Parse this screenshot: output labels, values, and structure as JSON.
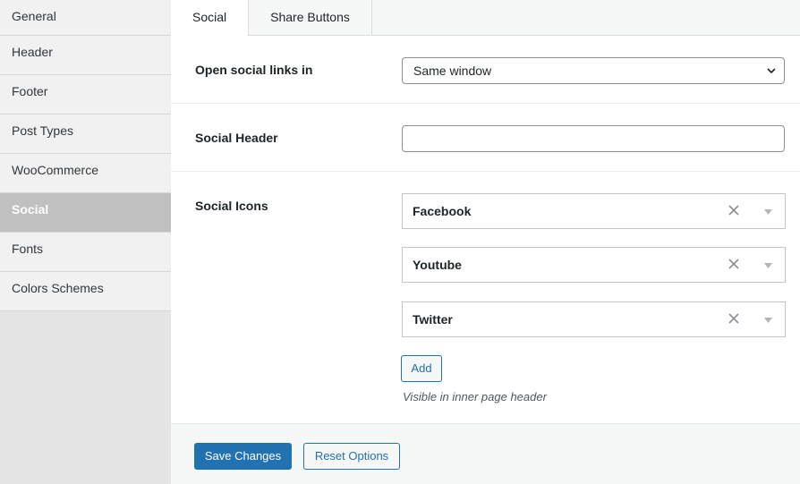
{
  "sidebar": {
    "items": [
      {
        "label": "General"
      },
      {
        "label": "Header"
      },
      {
        "label": "Footer"
      },
      {
        "label": "Post Types"
      },
      {
        "label": "WooCommerce"
      },
      {
        "label": "Social",
        "active": true
      },
      {
        "label": "Fonts"
      },
      {
        "label": "Colors Schemes"
      }
    ]
  },
  "tabs": [
    {
      "label": "Social",
      "active": true
    },
    {
      "label": "Share Buttons"
    }
  ],
  "open_links": {
    "label": "Open social links in",
    "value": "Same window"
  },
  "social_header": {
    "label": "Social Header",
    "value": ""
  },
  "social_icons": {
    "label": "Social Icons",
    "items": [
      {
        "name": "Facebook"
      },
      {
        "name": "Youtube"
      },
      {
        "name": "Twitter"
      }
    ],
    "add_label": "Add",
    "hint": "Visible in inner page header"
  },
  "footer": {
    "save_label": "Save Changes",
    "reset_label": "Reset Options"
  },
  "colors": {
    "accent": "#2271b1",
    "sidebar_active": "#c0c0c0"
  }
}
